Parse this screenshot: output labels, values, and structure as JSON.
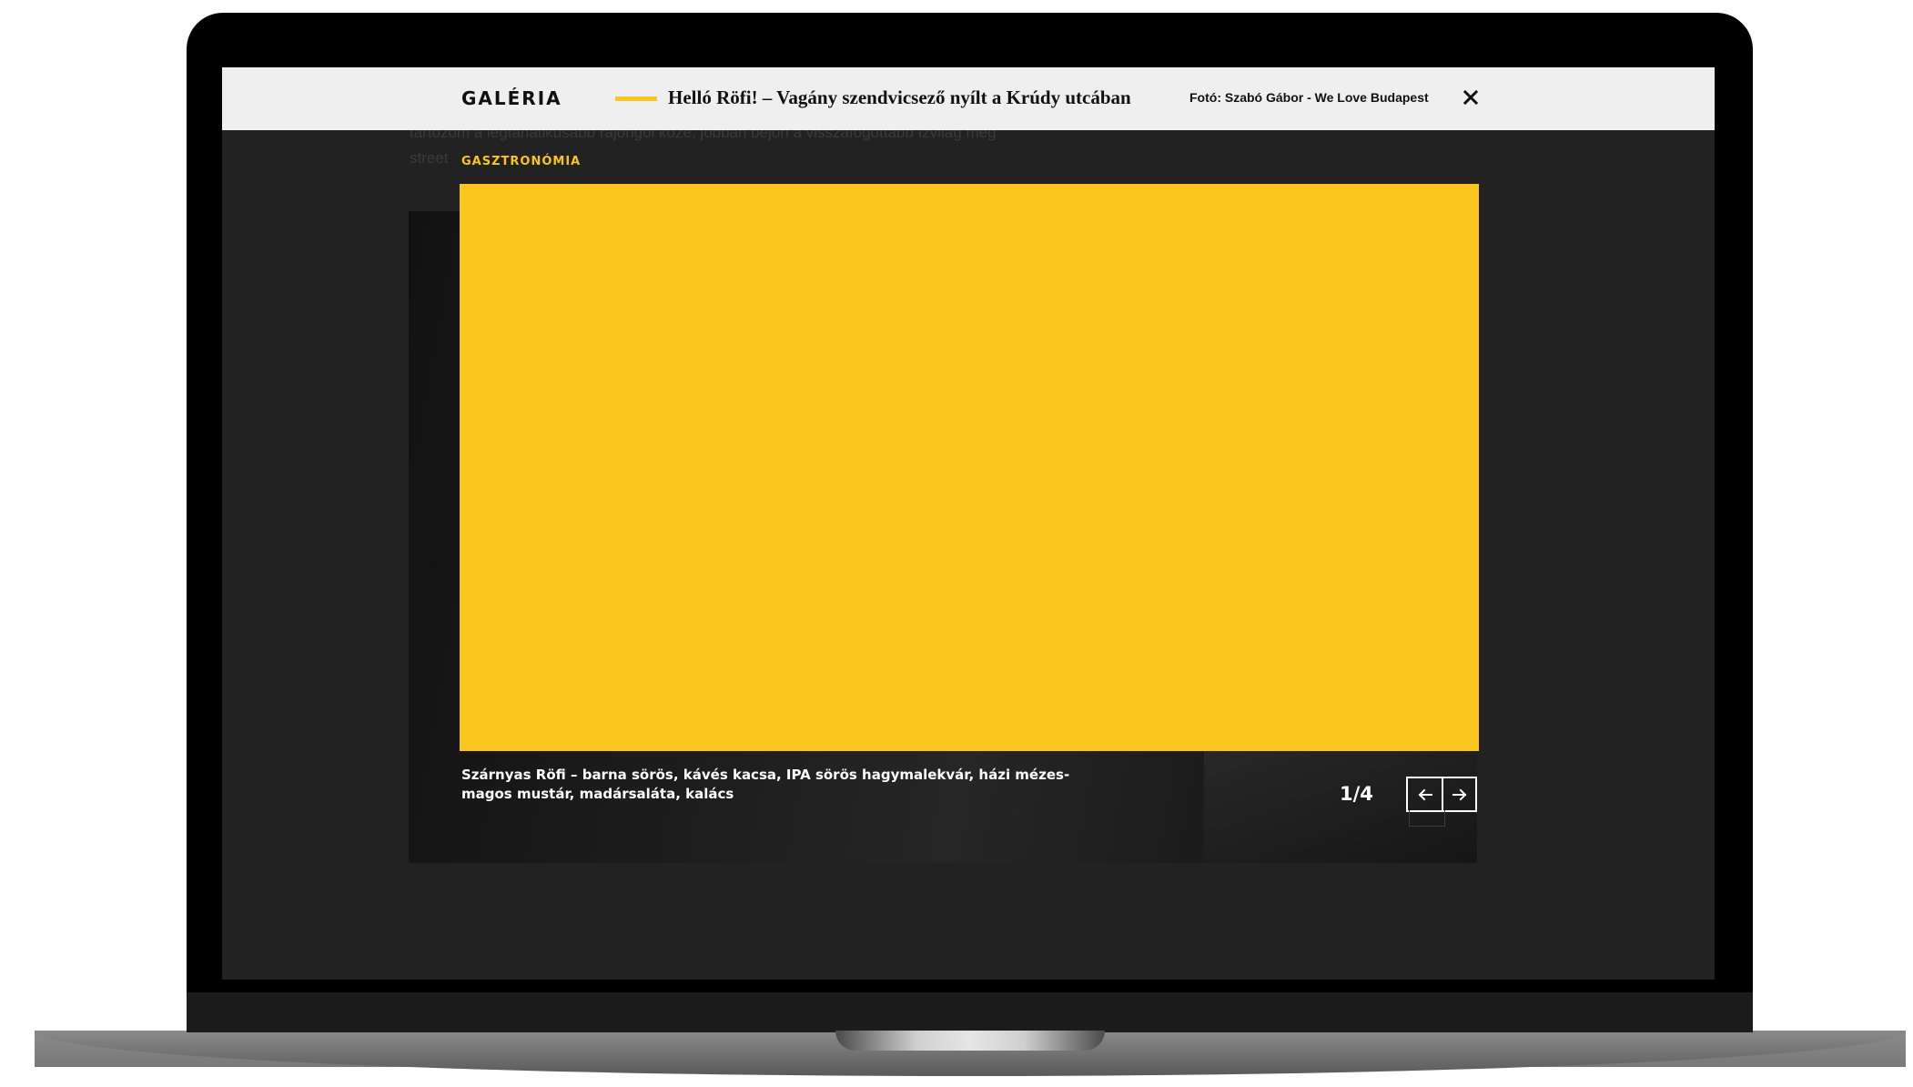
{
  "gallery": {
    "title": "GALÉRIA",
    "article_title": "Helló Röfi! – Vagány szendvicsező nyílt a Krúdy utcában",
    "photo_credit": "Fotó: Szabó Gábor - We Love Budapest",
    "category": "GASZTRONÓMIA",
    "caption": "Szárnyas Röfi – barna sörös, kávés kacsa, IPA sörös hagymalekvár, házi mézes-magos mustár, madársaláta, kalács",
    "counter": "1/4",
    "current_index": 1,
    "total": 4,
    "image_placeholder_color": "#fbc520"
  },
  "background_article": {
    "line_1": "tartozom a legfanatikusabb rajongói közé, jobban bejön a visszafogottabb ízvilág meg",
    "line_2": "street"
  },
  "icons": {
    "close": "close-icon",
    "prev": "arrow-left-icon",
    "next": "arrow-right-icon"
  },
  "colors": {
    "accent": "#fbc520",
    "header_bg": "#efefef",
    "overlay_bg": "#222222"
  }
}
